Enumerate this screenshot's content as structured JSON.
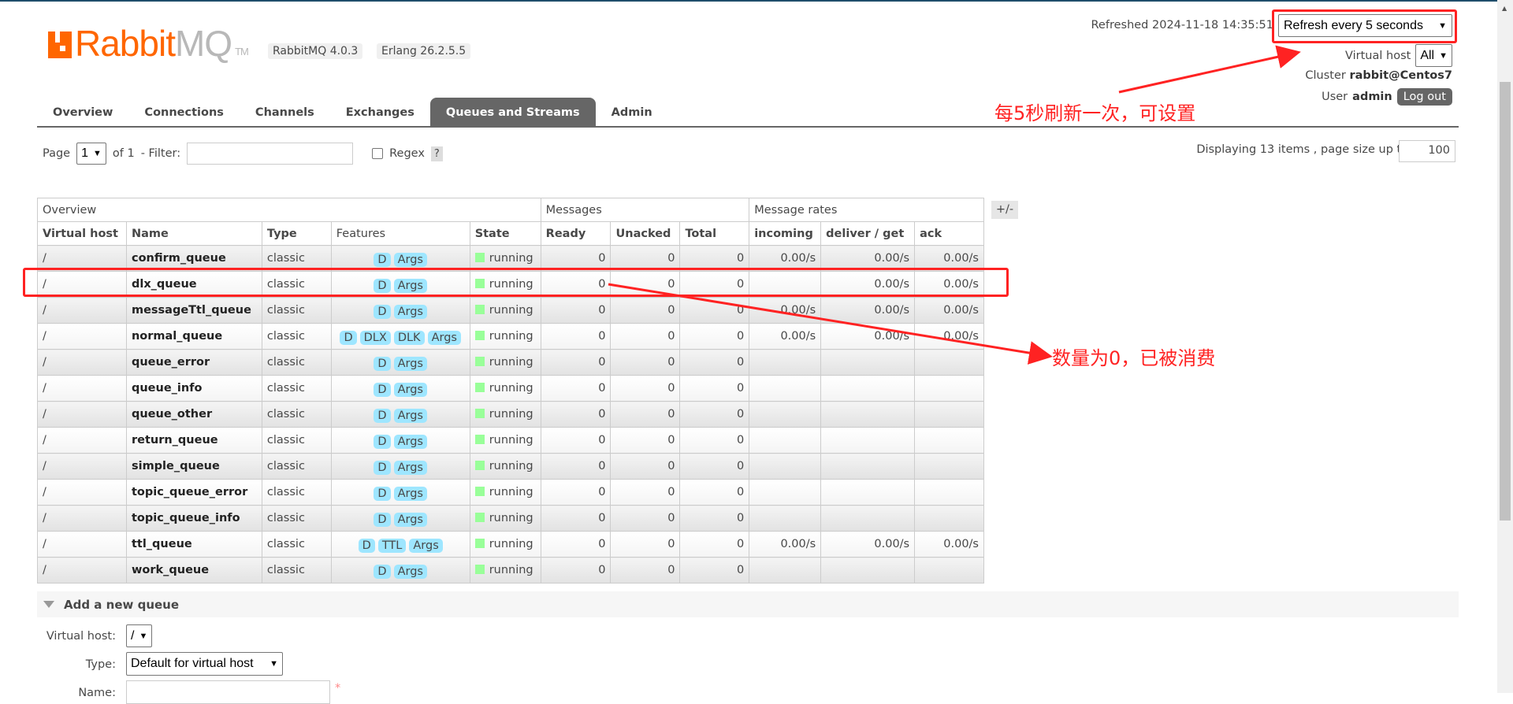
{
  "brand": {
    "logo": "RabbitMQ",
    "tm": "TM",
    "version": "RabbitMQ 4.0.3",
    "erlang": "Erlang 26.2.5.5",
    "color": "#ff6600"
  },
  "header": {
    "refreshed": "Refreshed 2024-11-18 14:35:51",
    "refresh_select": "Refresh every 5 seconds",
    "vhost_label": "Virtual host",
    "vhost_value": "All",
    "cluster_label": "Cluster",
    "cluster_value": "rabbit@Centos7",
    "user_label": "User",
    "user_value": "admin",
    "logout": "Log out"
  },
  "tabs": [
    {
      "label": "Overview"
    },
    {
      "label": "Connections"
    },
    {
      "label": "Channels"
    },
    {
      "label": "Exchanges"
    },
    {
      "label": "Queues and Streams",
      "active": true
    },
    {
      "label": "Admin"
    }
  ],
  "pager": {
    "page_label": "Page",
    "page_value": "1",
    "of": "of 1",
    "filter_label": "- Filter:",
    "filter_value": "",
    "regex_label": "Regex",
    "help": "?",
    "displaying": "Displaying 13 items , page size up to:",
    "page_size": "100"
  },
  "table": {
    "groups": [
      "Overview",
      "Messages",
      "Message rates"
    ],
    "columns": [
      "Virtual host",
      "Name",
      "Type",
      "Features",
      "State",
      "Ready",
      "Unacked",
      "Total",
      "incoming",
      "deliver / get",
      "ack"
    ],
    "toggle": "+/-",
    "rows": [
      {
        "vhost": "/",
        "name": "confirm_queue",
        "type": "classic",
        "features": [
          "D",
          "Args"
        ],
        "state": "running",
        "ready": "0",
        "unacked": "0",
        "total": "0",
        "incoming": "0.00/s",
        "deliver": "0.00/s",
        "ack": "0.00/s"
      },
      {
        "vhost": "/",
        "name": "dlx_queue",
        "type": "classic",
        "features": [
          "D",
          "Args"
        ],
        "state": "running",
        "ready": "0",
        "unacked": "0",
        "total": "0",
        "incoming": "",
        "deliver": "0.00/s",
        "ack": "0.00/s"
      },
      {
        "vhost": "/",
        "name": "messageTtl_queue",
        "type": "classic",
        "features": [
          "D",
          "Args"
        ],
        "state": "running",
        "ready": "0",
        "unacked": "0",
        "total": "0",
        "incoming": "0.00/s",
        "deliver": "0.00/s",
        "ack": "0.00/s"
      },
      {
        "vhost": "/",
        "name": "normal_queue",
        "type": "classic",
        "features": [
          "D",
          "DLX",
          "DLK",
          "Args"
        ],
        "state": "running",
        "ready": "0",
        "unacked": "0",
        "total": "0",
        "incoming": "0.00/s",
        "deliver": "0.00/s",
        "ack": "0.00/s"
      },
      {
        "vhost": "/",
        "name": "queue_error",
        "type": "classic",
        "features": [
          "D",
          "Args"
        ],
        "state": "running",
        "ready": "0",
        "unacked": "0",
        "total": "0",
        "incoming": "",
        "deliver": "",
        "ack": ""
      },
      {
        "vhost": "/",
        "name": "queue_info",
        "type": "classic",
        "features": [
          "D",
          "Args"
        ],
        "state": "running",
        "ready": "0",
        "unacked": "0",
        "total": "0",
        "incoming": "",
        "deliver": "",
        "ack": ""
      },
      {
        "vhost": "/",
        "name": "queue_other",
        "type": "classic",
        "features": [
          "D",
          "Args"
        ],
        "state": "running",
        "ready": "0",
        "unacked": "0",
        "total": "0",
        "incoming": "",
        "deliver": "",
        "ack": ""
      },
      {
        "vhost": "/",
        "name": "return_queue",
        "type": "classic",
        "features": [
          "D",
          "Args"
        ],
        "state": "running",
        "ready": "0",
        "unacked": "0",
        "total": "0",
        "incoming": "",
        "deliver": "",
        "ack": ""
      },
      {
        "vhost": "/",
        "name": "simple_queue",
        "type": "classic",
        "features": [
          "D",
          "Args"
        ],
        "state": "running",
        "ready": "0",
        "unacked": "0",
        "total": "0",
        "incoming": "",
        "deliver": "",
        "ack": ""
      },
      {
        "vhost": "/",
        "name": "topic_queue_error",
        "type": "classic",
        "features": [
          "D",
          "Args"
        ],
        "state": "running",
        "ready": "0",
        "unacked": "0",
        "total": "0",
        "incoming": "",
        "deliver": "",
        "ack": ""
      },
      {
        "vhost": "/",
        "name": "topic_queue_info",
        "type": "classic",
        "features": [
          "D",
          "Args"
        ],
        "state": "running",
        "ready": "0",
        "unacked": "0",
        "total": "0",
        "incoming": "",
        "deliver": "",
        "ack": ""
      },
      {
        "vhost": "/",
        "name": "ttl_queue",
        "type": "classic",
        "features": [
          "D",
          "TTL",
          "Args"
        ],
        "state": "running",
        "ready": "0",
        "unacked": "0",
        "total": "0",
        "incoming": "0.00/s",
        "deliver": "0.00/s",
        "ack": "0.00/s"
      },
      {
        "vhost": "/",
        "name": "work_queue",
        "type": "classic",
        "features": [
          "D",
          "Args"
        ],
        "state": "running",
        "ready": "0",
        "unacked": "0",
        "total": "0",
        "incoming": "",
        "deliver": "",
        "ack": ""
      }
    ]
  },
  "add_queue": {
    "title": "Add a new queue",
    "vhost_label": "Virtual host:",
    "vhost_value": "/",
    "type_label": "Type:",
    "type_value": "Default for virtual host",
    "name_label": "Name:",
    "required": "*"
  },
  "annotations": {
    "refresh_note": "每5秒刷新一次，可设置",
    "count_note": "数量为0，已被消费",
    "color": "#ff2222"
  }
}
